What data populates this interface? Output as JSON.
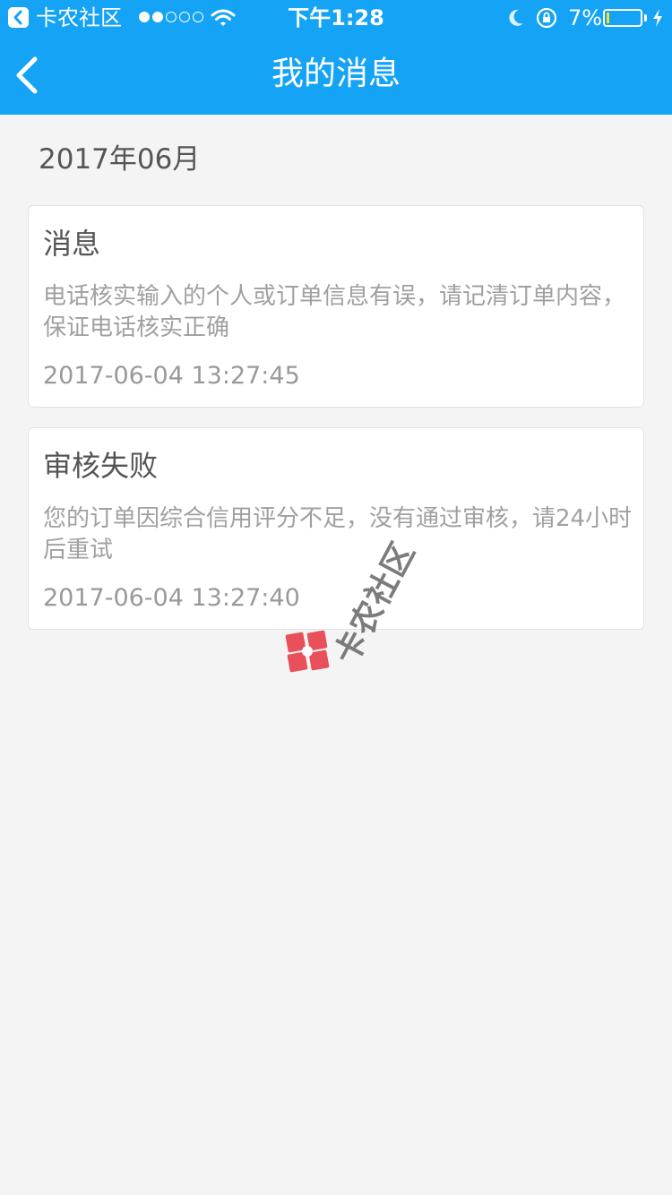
{
  "status_bar": {
    "app_name": "卡农社区",
    "time": "下午1:28",
    "battery": "7%",
    "battery_level": 0.07,
    "signal_bars": 2,
    "icons": [
      "back-to-app-icon",
      "signal-dots-icon",
      "wifi-icon",
      "moon-icon",
      "rotation-lock-icon",
      "battery-icon",
      "charging-bolt-icon"
    ]
  },
  "navbar": {
    "title": "我的消息",
    "back_icon": "chevron-left-icon"
  },
  "section": {
    "month": "2017年06月"
  },
  "messages": [
    {
      "title": "消息",
      "body": "电话核实输入的个人或订单信息有误，请记清订单内容，保证电话核实正确",
      "time": "2017-06-04 13:27:45"
    },
    {
      "title": "审核失败",
      "body": "您的订单因综合信用评分不足，没有通过审核，请24小时后重试",
      "time": "2017-06-04 13:27:40"
    }
  ],
  "watermark": {
    "text": "卡农社区"
  },
  "colors": {
    "header": "#14a3f5",
    "background": "#f4f4f4",
    "card": "#ffffff",
    "watermark_logo": "#e8505b"
  }
}
